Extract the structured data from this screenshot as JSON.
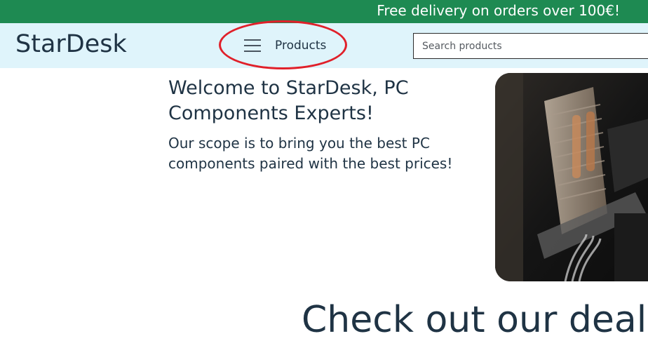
{
  "promo": {
    "text": "Free delivery on orders over 100€!"
  },
  "header": {
    "logo": "StarDesk",
    "products_label": "Products",
    "search_placeholder": "Search products"
  },
  "hero": {
    "title": "Welcome to StarDesk, PC Components Experts!",
    "text": "Our scope is to bring you the best PC components paired with the best prices!"
  },
  "deals": {
    "title": "Check out our deals"
  },
  "colors": {
    "promo_bg": "#1e8a52",
    "header_bg": "#dff4fb",
    "text": "#1f3344",
    "annotation": "#e0202a"
  }
}
